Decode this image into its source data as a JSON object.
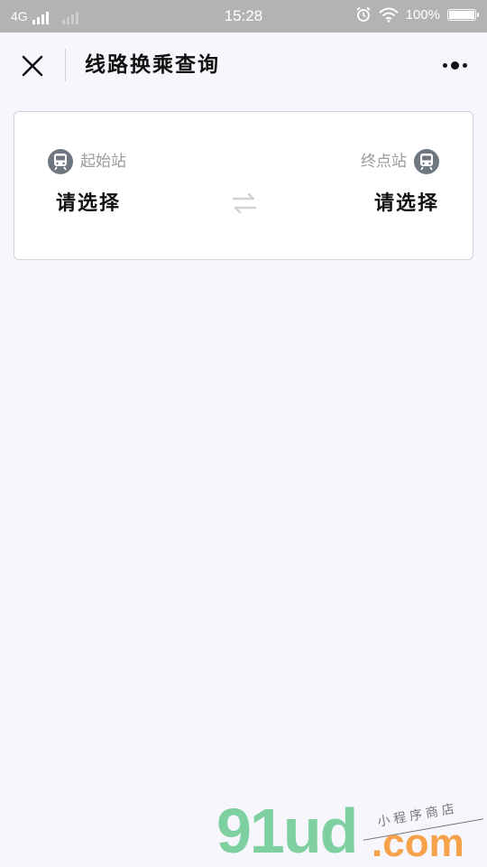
{
  "status_bar": {
    "network": "4G",
    "time": "15:28",
    "battery_text": "100%",
    "battery_level": 1.0
  },
  "nav": {
    "title": "线路换乘查询",
    "close_icon": "close-icon",
    "more_icon": "more-dots-icon"
  },
  "route": {
    "start_label": "起始站",
    "start_value": "请选择",
    "end_label": "终点站",
    "end_value": "请选择",
    "swap_icon": "swap-arrows-icon",
    "station_icon": "train-icon"
  },
  "watermark": {
    "main": "91ud",
    "suffix": ".com",
    "tagline": "小程序商店"
  },
  "colors": {
    "background": "#f7f6fc",
    "status_bar": "#b3b3b3",
    "card_border": "#d4d4d9",
    "muted_text": "#9a9a9a",
    "icon_gray": "#6e7780",
    "watermark_green": "#7ed0a1",
    "watermark_orange": "#f5a24b"
  }
}
